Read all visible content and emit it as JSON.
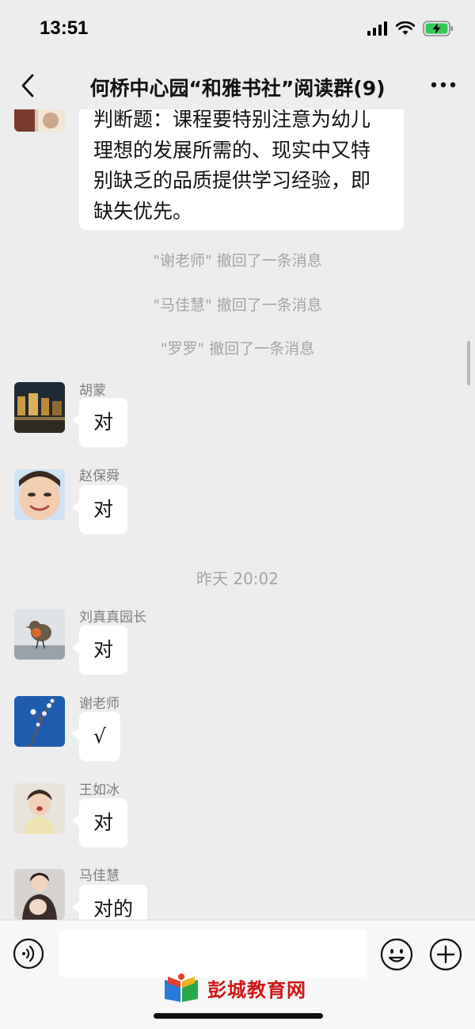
{
  "status_bar": {
    "time": "13:51"
  },
  "nav": {
    "title": "何桥中心园“和雅书社”阅读群(9)",
    "back_icon": "chevron-left-icon",
    "more_icon": "more-dots-icon"
  },
  "messages": {
    "question": {
      "text": "判断题：课程要特别注意为幼儿理想的发展所需的、现实中又特别缺乏的品质提供学习经验，即缺失优先。",
      "lines": [
        "判断题：课程要特别注意为幼儿",
        "理想的发展所需的、现实中又特",
        "别缺乏的品质提供学习经验，即",
        "缺失优先。"
      ]
    },
    "recalls": [
      "\"谢老师\" 撤回了一条消息",
      "\"马佳慧\" 撤回了一条消息",
      "\"罗罗\" 撤回了一条消息"
    ],
    "timestamp": "昨天 20:02",
    "chat": [
      {
        "sender": "胡蒙",
        "text": "对"
      },
      {
        "sender": "赵保舜",
        "text": "对"
      },
      {
        "sender": "刘真真园长",
        "text": "对"
      },
      {
        "sender": "谢老师",
        "text": "√"
      },
      {
        "sender": "王如冰",
        "text": "对"
      },
      {
        "sender": "马佳慧",
        "text": "对的"
      }
    ]
  },
  "input_bar": {
    "voice_icon": "voice-icon",
    "emoji_icon": "emoji-icon",
    "plus_icon": "plus-icon",
    "input_value": ""
  },
  "watermark": {
    "text": "彭城教育网"
  },
  "colors": {
    "background": "#ededed",
    "bubble": "#ffffff",
    "system_text": "#a4a4a4",
    "sender_text": "#7d7d7d",
    "battery_green": "#34c759",
    "watermark_red": "#d01616"
  }
}
